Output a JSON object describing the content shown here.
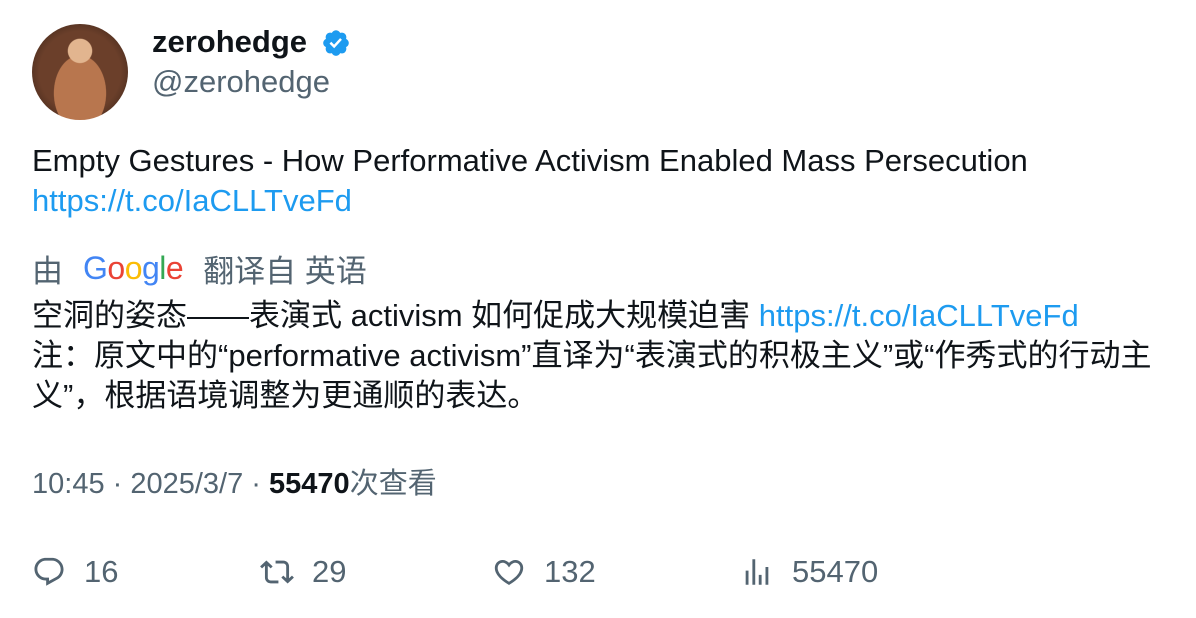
{
  "author": {
    "display_name": "zerohedge",
    "handle": "@zerohedge",
    "verified_color": "#1d9bf0"
  },
  "tweet": {
    "text": "Empty Gestures - How Performative Activism Enabled Mass Persecution",
    "link": "https://t.co/IaCLLTveFd"
  },
  "translation": {
    "prefix": "由",
    "provider": "Google",
    "suffix": "翻译自 英语",
    "text_before_link": "空洞的姿态——表演式 activism 如何促成大规模迫害 ",
    "link": "https://t.co/IaCLLTveFd",
    "note": "注：原文中的“performative activism”直译为“表演式的积极主义”或“作秀式的行动主义”，根据语境调整为更通顺的表达。"
  },
  "meta": {
    "time": "10:45",
    "separator": " · ",
    "date": "2025/3/7",
    "views_count": "55470",
    "views_label": "次查看"
  },
  "actions": {
    "replies": "16",
    "retweets": "29",
    "likes": "132",
    "views": "55470"
  },
  "colors": {
    "text": "#0f1419",
    "secondary": "#536471",
    "link": "#1d9bf0"
  }
}
